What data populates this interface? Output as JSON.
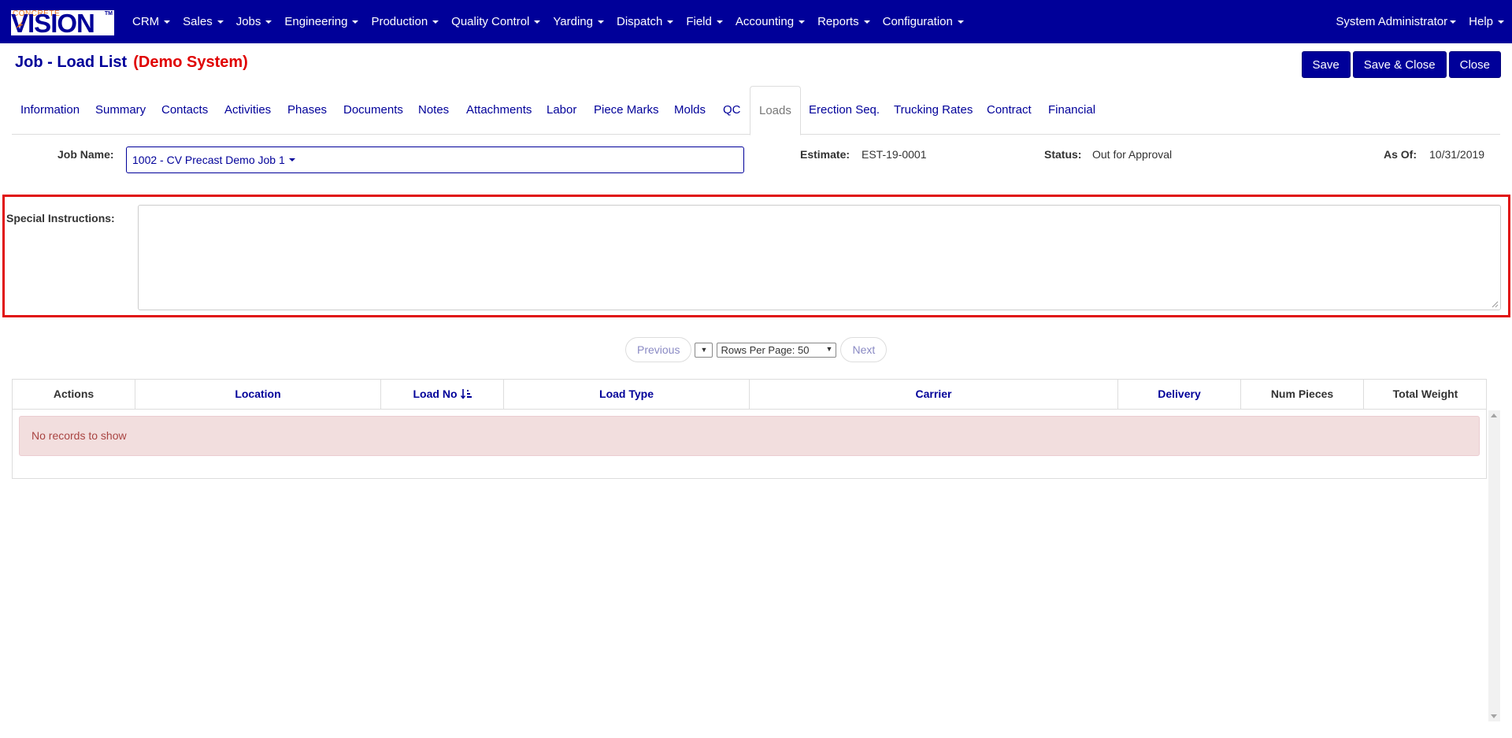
{
  "app": {
    "logo_small": "CONCRETE",
    "logo_big": "VISION",
    "logo_tm": "TM"
  },
  "nav": {
    "items": [
      {
        "label": "CRM"
      },
      {
        "label": "Sales"
      },
      {
        "label": "Jobs"
      },
      {
        "label": "Engineering"
      },
      {
        "label": "Production"
      },
      {
        "label": "Quality Control"
      },
      {
        "label": "Yarding"
      },
      {
        "label": "Dispatch"
      },
      {
        "label": "Field"
      },
      {
        "label": "Accounting"
      },
      {
        "label": "Reports"
      },
      {
        "label": "Configuration"
      }
    ],
    "user": "System Administrator",
    "help": "Help"
  },
  "page": {
    "title": "Job - Load List",
    "demo_label": "(Demo System)"
  },
  "actions": {
    "save": "Save",
    "save_close": "Save & Close",
    "close": "Close"
  },
  "tabs": [
    {
      "label": "Information"
    },
    {
      "label": "Summary"
    },
    {
      "label": "Contacts"
    },
    {
      "label": "Activities"
    },
    {
      "label": "Phases"
    },
    {
      "label": "Documents"
    },
    {
      "label": "Notes"
    },
    {
      "label": "Attachments"
    },
    {
      "label": "Labor"
    },
    {
      "label": "Piece Marks"
    },
    {
      "label": "Molds"
    },
    {
      "label": "QC"
    },
    {
      "label": "Loads",
      "active": true
    },
    {
      "label": "Erection Seq."
    },
    {
      "label": "Trucking Rates"
    },
    {
      "label": "Contract"
    },
    {
      "label": "Financial"
    }
  ],
  "job": {
    "name_label": "Job Name:",
    "name_value": "1002 - CV Precast Demo Job 1",
    "estimate_label": "Estimate:",
    "estimate_value": "EST-19-0001",
    "status_label": "Status:",
    "status_value": "Out for Approval",
    "asof_label": "As Of:",
    "asof_value": "10/31/2019"
  },
  "special_instructions": {
    "label": "Special Instructions:",
    "value": ""
  },
  "pager": {
    "previous": "Previous",
    "page_select": "▼",
    "rows_per_page": "Rows Per Page: 50",
    "next": "Next"
  },
  "table": {
    "columns": [
      {
        "label": "Actions"
      },
      {
        "label": "Location"
      },
      {
        "label": "Load No"
      },
      {
        "label": "Load Type"
      },
      {
        "label": "Carrier"
      },
      {
        "label": "Delivery"
      },
      {
        "label": "Num Pieces"
      },
      {
        "label": "Total Weight"
      }
    ],
    "empty_message": "No records to show"
  },
  "colors": {
    "brand": "#000099",
    "demo": "#e00000",
    "highlight": "#e01010",
    "alert_bg": "#f2dede",
    "alert_text": "#a94442"
  }
}
